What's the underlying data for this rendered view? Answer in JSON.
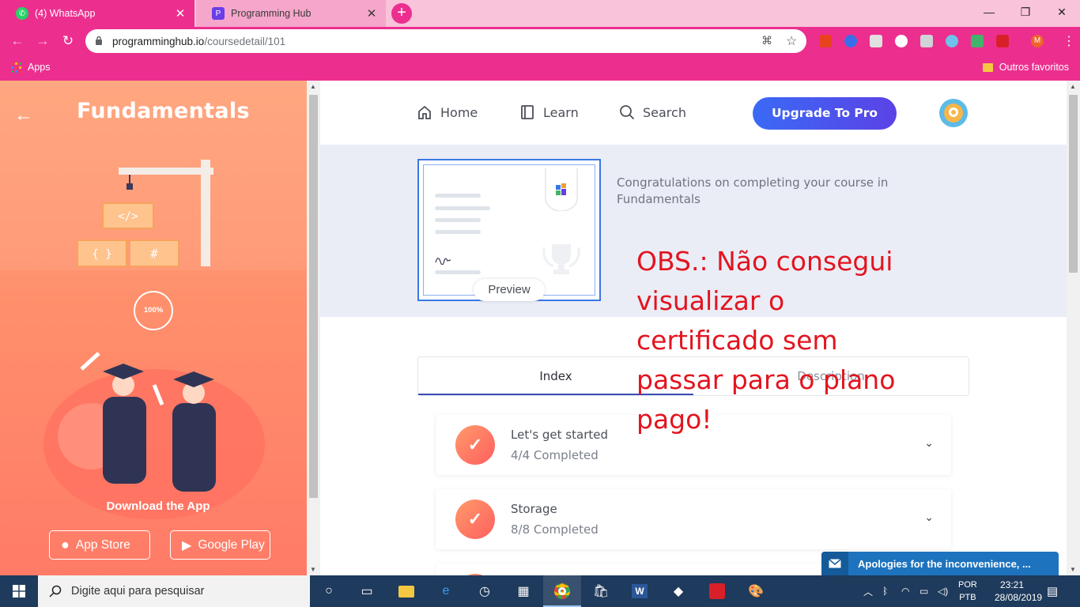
{
  "browser": {
    "tabs": [
      {
        "title": "(4) WhatsApp",
        "favicon": "whatsapp-icon"
      },
      {
        "title": "Programming Hub",
        "favicon": "programming-hub-icon"
      }
    ],
    "url_host": "programminghub.io",
    "url_path": "/coursedetail/101",
    "bookmarks": {
      "apps_label": "Apps",
      "other_label": "Outros favoritos"
    },
    "extension_badge": "M",
    "accent": "#ec2f8f"
  },
  "sidebar": {
    "title": "Fundamentals",
    "progress": "100%",
    "download_text": "Download the App",
    "app_store_label": "App Store",
    "google_play_label": "Google Play"
  },
  "nav": {
    "home": "Home",
    "learn": "Learn",
    "search": "Search",
    "upgrade": "Upgrade To Pro"
  },
  "certificate": {
    "preview_label": "Preview",
    "congrats_text": "Congratulations on completing your course in Fundamentals"
  },
  "annotation": {
    "lines": [
      "OBS.: Não consegui",
      "visualizar o",
      "certificado sem",
      "passar para o plano",
      "pago!"
    ],
    "color": "#e3141f"
  },
  "course_tabs": {
    "index": "Index",
    "description": "Description"
  },
  "modules": [
    {
      "name": "Let's get started",
      "progress": "4/4 Completed"
    },
    {
      "name": "Storage",
      "progress": "8/8 Completed"
    }
  ],
  "chat": {
    "text": "Apologies for the inconvenience, ..."
  },
  "taskbar": {
    "search_placeholder": "Digite aqui para pesquisar",
    "lang_top": "POR",
    "lang_bottom": "PTB",
    "time": "23:21",
    "date": "28/08/2019"
  }
}
